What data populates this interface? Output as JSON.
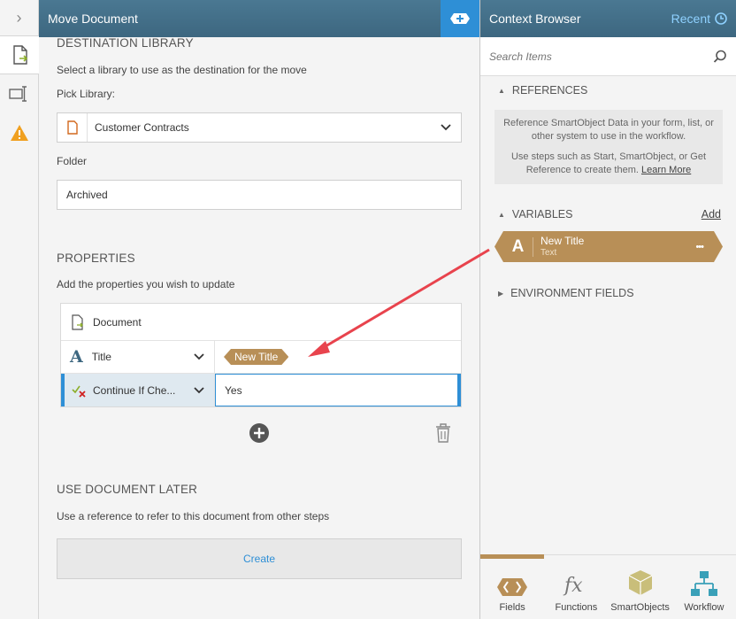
{
  "rail": {
    "toggle_glyph": "›"
  },
  "main": {
    "title": "Move Document",
    "destination": {
      "heading": "DESTINATION LIBRARY",
      "description": "Select a library to use as the destination for the move",
      "pick_label": "Pick Library:",
      "library_value": "Customer Contracts",
      "folder_label": "Folder",
      "folder_value": "Archived"
    },
    "properties": {
      "heading": "PROPERTIES",
      "description": "Add the properties you wish to update",
      "header_label": "Document",
      "rows": [
        {
          "key": "Title",
          "value_token": "New Title"
        },
        {
          "key": "Continue If Che...",
          "value": "Yes"
        }
      ]
    },
    "later": {
      "heading": "USE DOCUMENT LATER",
      "description": "Use a reference to refer to this document from other steps",
      "create_label": "Create"
    }
  },
  "ctx": {
    "title": "Context Browser",
    "recent_label": "Recent",
    "search_placeholder": "Search Items",
    "references_heading": "REFERENCES",
    "ref_note_1": "Reference SmartObject Data in your form, list, or other system to use in the workflow.",
    "ref_note_2": "Use steps such as Start, SmartObject, or Get Reference to create them.",
    "learn_more": "Learn More",
    "variables_heading": "VARIABLES",
    "add_label": "Add",
    "variable": {
      "name": "New Title",
      "type": "Text",
      "glyph": "A",
      "menu": "•••"
    },
    "environment_heading": "ENVIRONMENT FIELDS",
    "tabs": [
      {
        "label": "Fields"
      },
      {
        "label": "Functions"
      },
      {
        "label": "SmartObjects"
      },
      {
        "label": "Workflow"
      }
    ]
  },
  "colors": {
    "accent_brown": "#b88f57",
    "header_blue": "#3d6780",
    "link_blue": "#2e8fd6",
    "arrow_red": "#e8434d"
  }
}
